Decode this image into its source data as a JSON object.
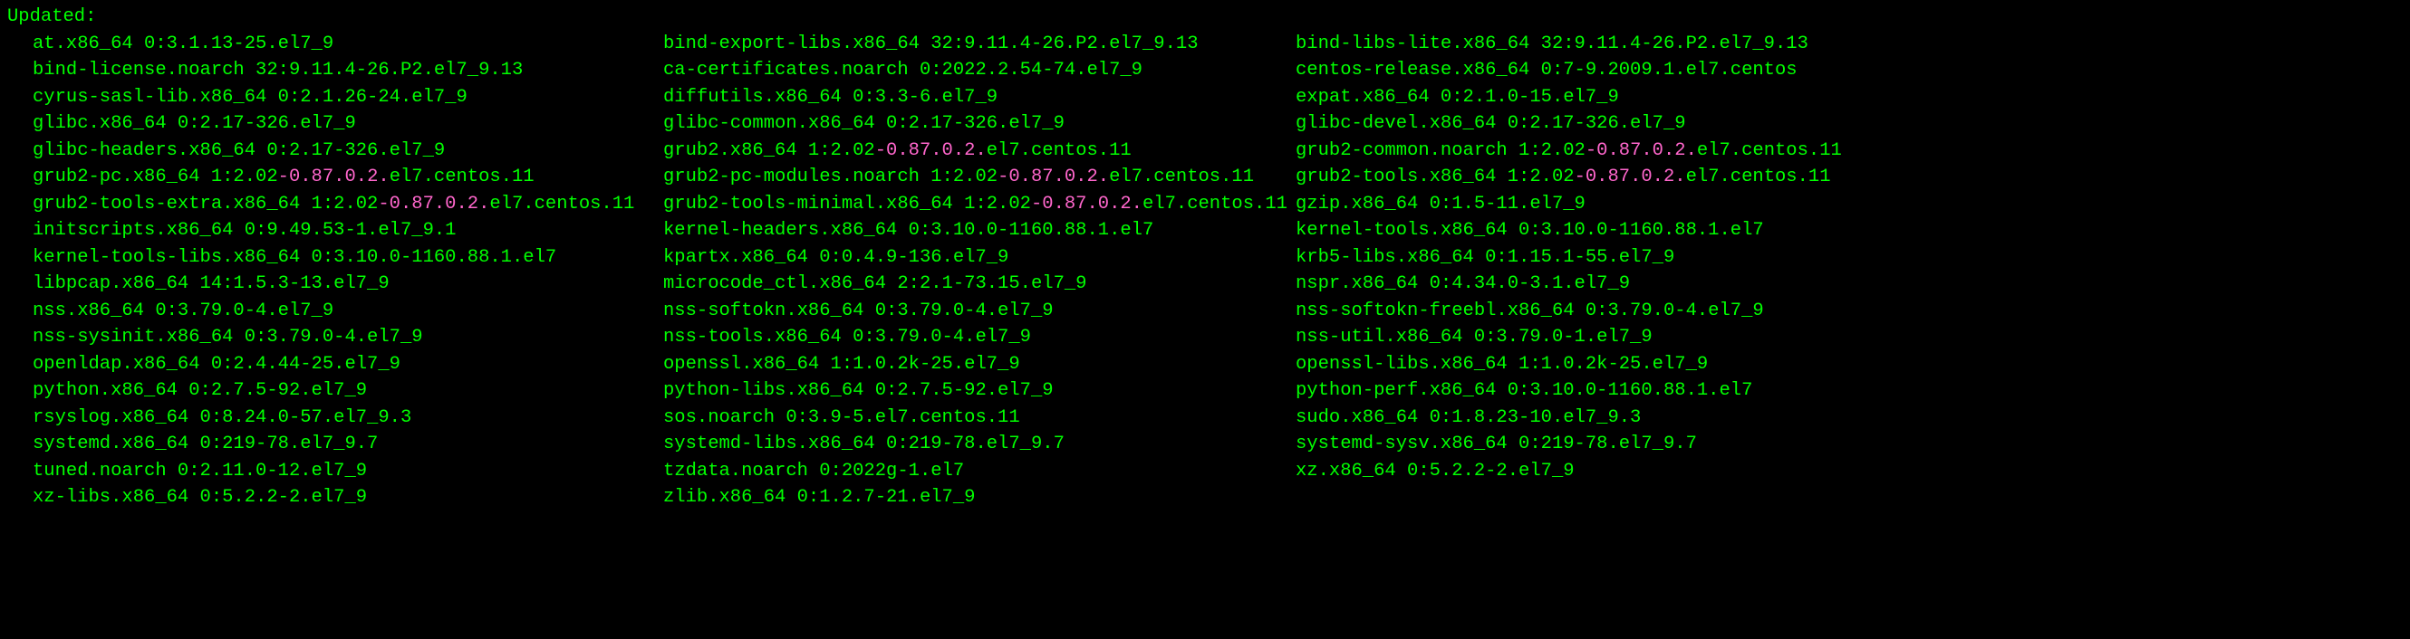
{
  "header": "Updated:",
  "columns": [
    [
      "at.x86_64 0:3.1.13-25.el7_9",
      "bind-license.noarch 32:9.11.4-26.P2.el7_9.13",
      "cyrus-sasl-lib.x86_64 0:2.1.26-24.el7_9",
      "glibc.x86_64 0:2.17-326.el7_9",
      "glibc-headers.x86_64 0:2.17-326.el7_9",
      "grub2-pc.x86_64 1:2.02-0.87.0.2.el7.centos.11",
      "grub2-tools-extra.x86_64 1:2.02-0.87.0.2.el7.centos.11",
      "initscripts.x86_64 0:9.49.53-1.el7_9.1",
      "kernel-tools-libs.x86_64 0:3.10.0-1160.88.1.el7",
      "libpcap.x86_64 14:1.5.3-13.el7_9",
      "nss.x86_64 0:3.79.0-4.el7_9",
      "nss-sysinit.x86_64 0:3.79.0-4.el7_9",
      "openldap.x86_64 0:2.4.44-25.el7_9",
      "python.x86_64 0:2.7.5-92.el7_9",
      "rsyslog.x86_64 0:8.24.0-57.el7_9.3",
      "systemd.x86_64 0:219-78.el7_9.7",
      "tuned.noarch 0:2.11.0-12.el7_9",
      "xz-libs.x86_64 0:5.2.2-2.el7_9"
    ],
    [
      "bind-export-libs.x86_64 32:9.11.4-26.P2.el7_9.13",
      "ca-certificates.noarch 0:2022.2.54-74.el7_9",
      "diffutils.x86_64 0:3.3-6.el7_9",
      "glibc-common.x86_64 0:2.17-326.el7_9",
      "grub2.x86_64 1:2.02-0.87.0.2.el7.centos.11",
      "grub2-pc-modules.noarch 1:2.02-0.87.0.2.el7.centos.11",
      "grub2-tools-minimal.x86_64 1:2.02-0.87.0.2.el7.centos.11",
      "kernel-headers.x86_64 0:3.10.0-1160.88.1.el7",
      "kpartx.x86_64 0:0.4.9-136.el7_9",
      "microcode_ctl.x86_64 2:2.1-73.15.el7_9",
      "nss-softokn.x86_64 0:3.79.0-4.el7_9",
      "nss-tools.x86_64 0:3.79.0-4.el7_9",
      "openssl.x86_64 1:1.0.2k-25.el7_9",
      "python-libs.x86_64 0:2.7.5-92.el7_9",
      "sos.noarch 0:3.9-5.el7.centos.11",
      "systemd-libs.x86_64 0:219-78.el7_9.7",
      "tzdata.noarch 0:2022g-1.el7",
      "zlib.x86_64 0:1.2.7-21.el7_9"
    ],
    [
      "bind-libs-lite.x86_64 32:9.11.4-26.P2.el7_9.13",
      "centos-release.x86_64 0:7-9.2009.1.el7.centos",
      "expat.x86_64 0:2.1.0-15.el7_9",
      "glibc-devel.x86_64 0:2.17-326.el7_9",
      "grub2-common.noarch 1:2.02-0.87.0.2.el7.centos.11",
      "grub2-tools.x86_64 1:2.02-0.87.0.2.el7.centos.11",
      "gzip.x86_64 0:1.5-11.el7_9",
      "kernel-tools.x86_64 0:3.10.0-1160.88.1.el7",
      "krb5-libs.x86_64 0:1.15.1-55.el7_9",
      "nspr.x86_64 0:4.34.0-3.1.el7_9",
      "nss-softokn-freebl.x86_64 0:3.79.0-4.el7_9",
      "nss-util.x86_64 0:3.79.0-1.el7_9",
      "openssl-libs.x86_64 1:1.0.2k-25.el7_9",
      "python-perf.x86_64 0:3.10.0-1160.88.1.el7",
      "sudo.x86_64 0:1.8.23-10.el7_9.3",
      "systemd-sysv.x86_64 0:219-78.el7_9.7",
      "xz.x86_64 0:5.2.2-2.el7_9"
    ]
  ]
}
